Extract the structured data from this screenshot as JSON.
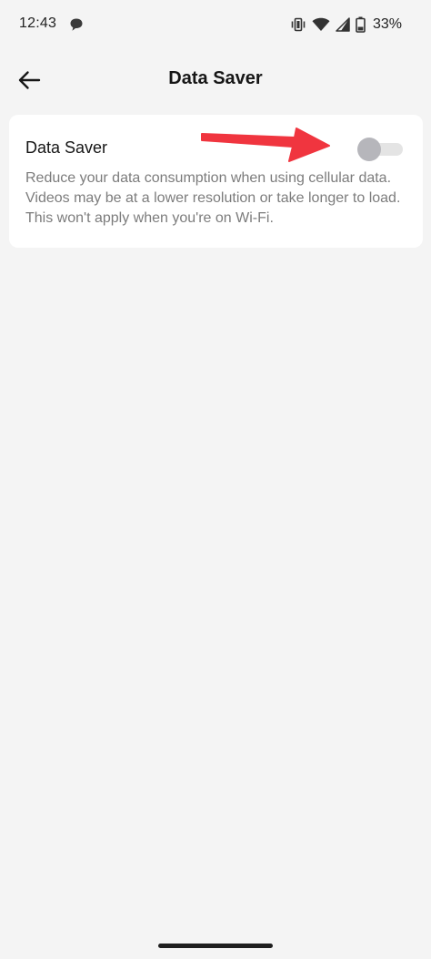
{
  "status_bar": {
    "time": "12:43",
    "battery_percent": "33%",
    "icons": [
      "chat-bubble-icon",
      "vibrate-icon",
      "wifi-icon",
      "cell-signal-icon",
      "battery-icon"
    ]
  },
  "app_bar": {
    "title": "Data Saver",
    "back_icon": "back-arrow-icon"
  },
  "setting": {
    "title": "Data Saver",
    "description": "Reduce your data consumption when using cellular data. Videos may be at a lower resolution or take longer to load. This won't apply when you're on Wi-Fi.",
    "enabled": false
  },
  "colors": {
    "background": "#f4f4f4",
    "card": "#ffffff",
    "annotation_arrow": "#f0353f",
    "toggle_thumb_off": "#b6b6bb",
    "toggle_track_off": "#e4e4e4"
  }
}
